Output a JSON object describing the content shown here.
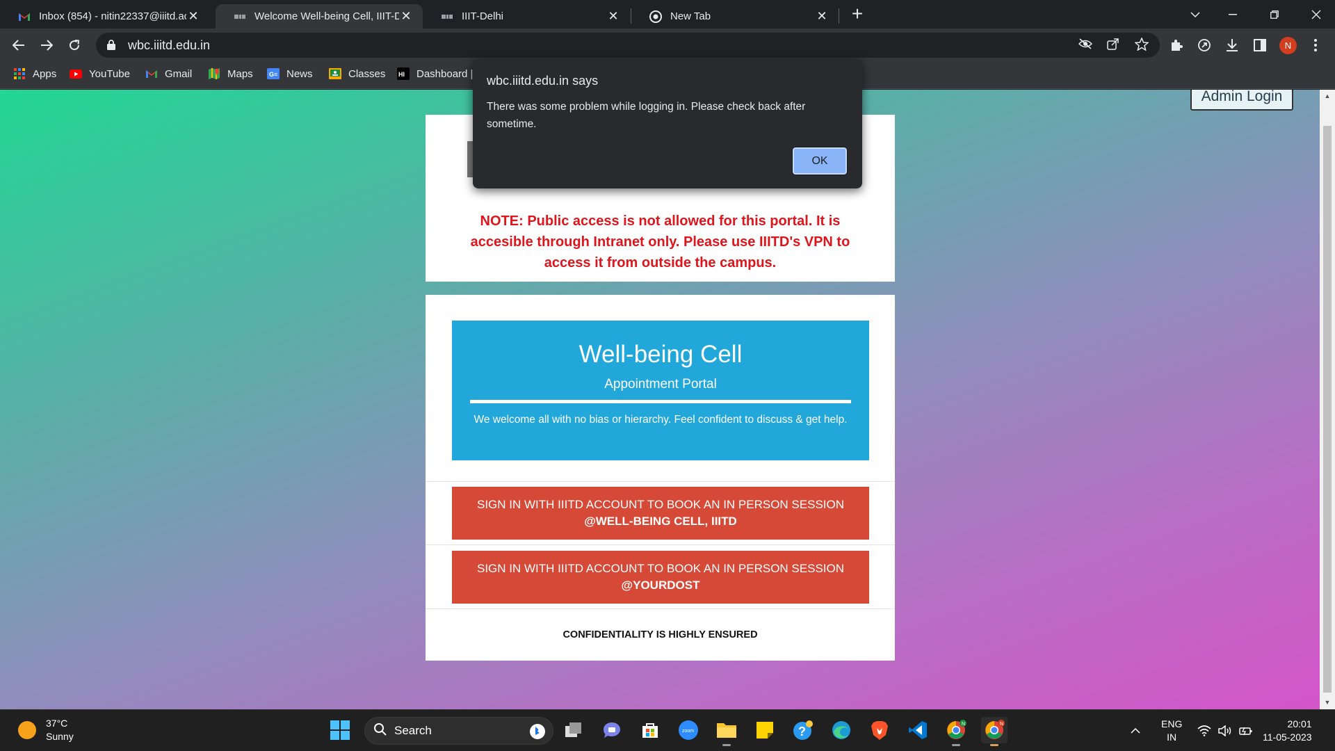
{
  "tabs": [
    {
      "title": "Inbox (854) - nitin22337@iiitd.ac.in",
      "icon": "gmail-icon"
    },
    {
      "title": "Welcome Well-being Cell, IIIT-Delhi",
      "icon": "site-icon"
    },
    {
      "title": "IIIT-Delhi",
      "icon": "site-icon"
    },
    {
      "title": "New Tab",
      "icon": "chrome-icon"
    }
  ],
  "address_bar": {
    "url": "wbc.iiitd.edu.in"
  },
  "profile_initial": "N",
  "bookmarks": [
    {
      "label": "Apps",
      "icon": "apps-grid-icon"
    },
    {
      "label": "YouTube",
      "icon": "youtube-icon"
    },
    {
      "label": "Gmail",
      "icon": "gmail-icon"
    },
    {
      "label": "Maps",
      "icon": "maps-icon"
    },
    {
      "label": "News",
      "icon": "news-icon"
    },
    {
      "label": "Classes",
      "icon": "classroom-icon"
    },
    {
      "label": "Dashboard |",
      "icon": "dashboard-icon"
    }
  ],
  "page": {
    "admin_login": "Admin Login",
    "note": "NOTE: Public access is not allowed for this portal. It is accesible through Intranet only. Please use IIITD's VPN to access it from outside the campus.",
    "banner": {
      "title": "Well-being Cell",
      "subtitle": "Appointment Portal",
      "welcome": "We welcome all with no bias or hierarchy. Feel confident to discuss & get help."
    },
    "signin_wbc": {
      "line1": "SIGN IN WITH IIITD ACCOUNT TO BOOK AN IN PERSON SESSION",
      "line2": "@WELL-BEING CELL, IIITD"
    },
    "signin_yourdost": {
      "line1": "SIGN IN WITH IIITD ACCOUNT TO BOOK AN IN PERSON SESSION",
      "line2": "@YOURDOST"
    },
    "confidentiality": "CONFIDENTIALITY IS HIGHLY ENSURED"
  },
  "dialog": {
    "header": "wbc.iiitd.edu.in says",
    "message": "There was some problem while logging in. Please check back after sometime.",
    "ok_label": "OK"
  },
  "taskbar": {
    "weather": {
      "temp": "37°C",
      "condition": "Sunny"
    },
    "search_label": "Search",
    "language": {
      "line1": "ENG",
      "line2": "IN"
    },
    "time": "20:01",
    "date": "11-05-2023"
  },
  "colors": {
    "accent_blue": "#21a7d9",
    "signin_red": "#d64937",
    "note_red": "#e0141b",
    "dialog_ok": "#8ab4f8"
  }
}
